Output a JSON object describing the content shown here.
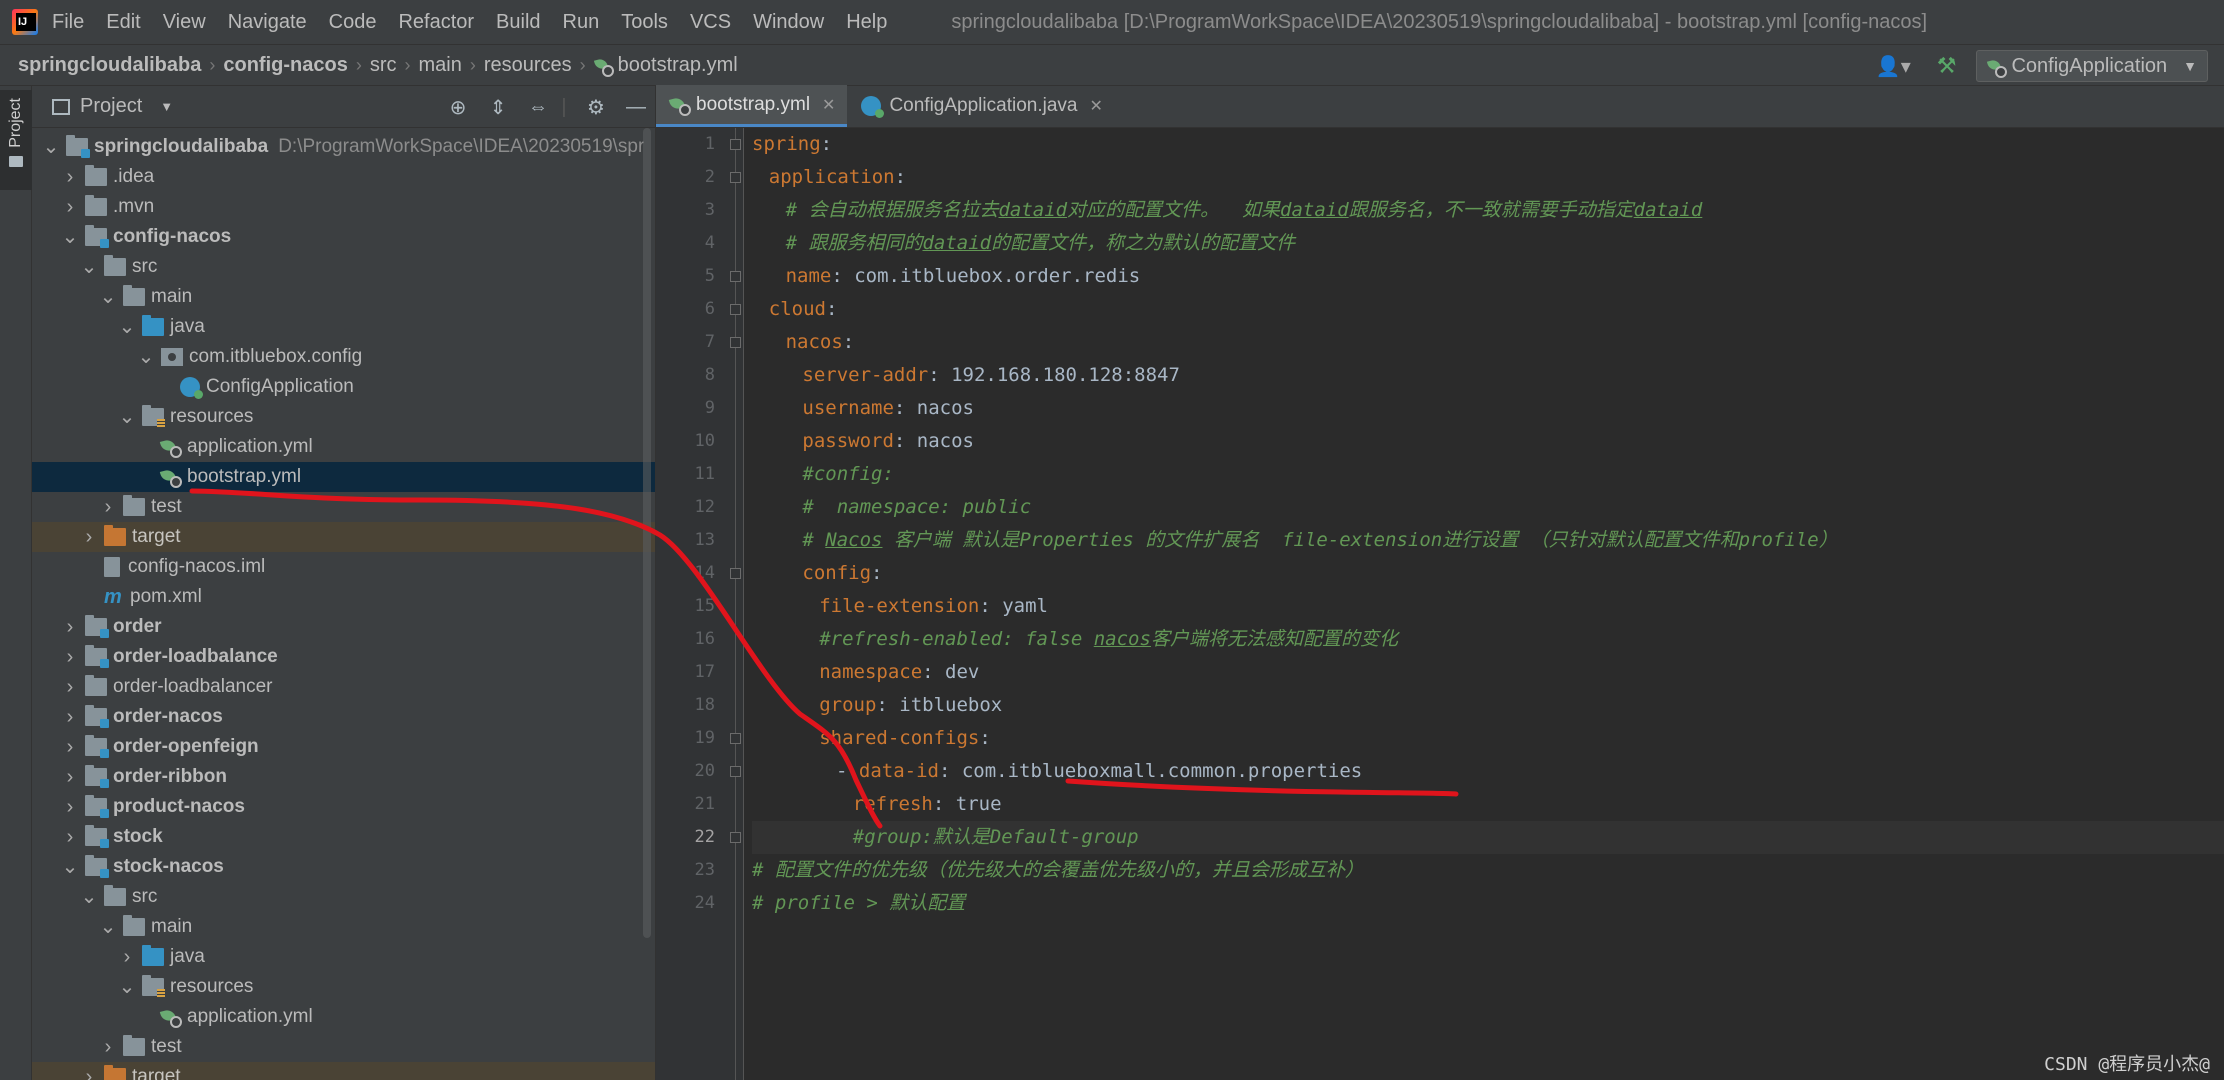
{
  "window": {
    "title": "springcloudalibaba [D:\\ProgramWorkSpace\\IDEA\\20230519\\springcloudalibaba] - bootstrap.yml [config-nacos]"
  },
  "menu": {
    "items": [
      "File",
      "Edit",
      "View",
      "Navigate",
      "Code",
      "Refactor",
      "Build",
      "Run",
      "Tools",
      "VCS",
      "Window",
      "Help"
    ]
  },
  "breadcrumb": {
    "items": [
      "springcloudalibaba",
      "config-nacos",
      "src",
      "main",
      "resources",
      "bootstrap.yml"
    ]
  },
  "toolbar": {
    "run_config": "ConfigApplication"
  },
  "side_strip": {
    "project_label": "Project"
  },
  "project_panel": {
    "title": "Project",
    "root_path": "D:\\ProgramWorkSpace\\IDEA\\20230519\\spr",
    "tree": [
      {
        "label": "springcloudalibaba",
        "indent": 0,
        "arrow": "down",
        "icon": "module",
        "bold": true
      },
      {
        "label": ".idea",
        "indent": 1,
        "arrow": "right",
        "icon": "folder"
      },
      {
        "label": ".mvn",
        "indent": 1,
        "arrow": "right",
        "icon": "folder"
      },
      {
        "label": "config-nacos",
        "indent": 1,
        "arrow": "down",
        "icon": "module",
        "bold": true
      },
      {
        "label": "src",
        "indent": 2,
        "arrow": "down",
        "icon": "folder"
      },
      {
        "label": "main",
        "indent": 3,
        "arrow": "down",
        "icon": "folder"
      },
      {
        "label": "java",
        "indent": 4,
        "arrow": "down",
        "icon": "src"
      },
      {
        "label": "com.itbluebox.config",
        "indent": 5,
        "arrow": "down",
        "icon": "package"
      },
      {
        "label": "ConfigApplication",
        "indent": 6,
        "arrow": "",
        "icon": "class"
      },
      {
        "label": "resources",
        "indent": 4,
        "arrow": "down",
        "icon": "resources"
      },
      {
        "label": "application.yml",
        "indent": 5,
        "arrow": "",
        "icon": "yml"
      },
      {
        "label": "bootstrap.yml",
        "indent": 5,
        "arrow": "",
        "icon": "yml",
        "selected": true
      },
      {
        "label": "test",
        "indent": 3,
        "arrow": "right",
        "icon": "folder"
      },
      {
        "label": "target",
        "indent": 2,
        "arrow": "right",
        "icon": "orange",
        "excluded": true
      },
      {
        "label": "config-nacos.iml",
        "indent": 2,
        "arrow": "",
        "icon": "iml"
      },
      {
        "label": "pom.xml",
        "indent": 2,
        "arrow": "",
        "icon": "maven"
      },
      {
        "label": "order",
        "indent": 1,
        "arrow": "right",
        "icon": "module",
        "bold": true
      },
      {
        "label": "order-loadbalance",
        "indent": 1,
        "arrow": "right",
        "icon": "module",
        "bold": true
      },
      {
        "label": "order-loadbalancer",
        "indent": 1,
        "arrow": "right",
        "icon": "folder"
      },
      {
        "label": "order-nacos",
        "indent": 1,
        "arrow": "right",
        "icon": "module",
        "bold": true
      },
      {
        "label": "order-openfeign",
        "indent": 1,
        "arrow": "right",
        "icon": "module",
        "bold": true
      },
      {
        "label": "order-ribbon",
        "indent": 1,
        "arrow": "right",
        "icon": "module",
        "bold": true
      },
      {
        "label": "product-nacos",
        "indent": 1,
        "arrow": "right",
        "icon": "module",
        "bold": true
      },
      {
        "label": "stock",
        "indent": 1,
        "arrow": "right",
        "icon": "module",
        "bold": true
      },
      {
        "label": "stock-nacos",
        "indent": 1,
        "arrow": "down",
        "icon": "module",
        "bold": true
      },
      {
        "label": "src",
        "indent": 2,
        "arrow": "down",
        "icon": "folder"
      },
      {
        "label": "main",
        "indent": 3,
        "arrow": "down",
        "icon": "folder"
      },
      {
        "label": "java",
        "indent": 4,
        "arrow": "right",
        "icon": "src"
      },
      {
        "label": "resources",
        "indent": 4,
        "arrow": "down",
        "icon": "resources"
      },
      {
        "label": "application.yml",
        "indent": 5,
        "arrow": "",
        "icon": "yml"
      },
      {
        "label": "test",
        "indent": 3,
        "arrow": "right",
        "icon": "folder"
      },
      {
        "label": "target",
        "indent": 2,
        "arrow": "right",
        "icon": "orange",
        "excluded": true
      }
    ]
  },
  "tabs": [
    {
      "label": "bootstrap.yml",
      "active": true,
      "icon": "yml"
    },
    {
      "label": "ConfigApplication.java",
      "active": false,
      "icon": "java"
    }
  ],
  "editor": {
    "current_line": 22,
    "lines": [
      {
        "n": 1,
        "indent": 0,
        "parts": [
          [
            "k",
            "spring"
          ],
          [
            "v",
            ":"
          ]
        ]
      },
      {
        "n": 2,
        "indent": 1,
        "parts": [
          [
            "k",
            "application"
          ],
          [
            "v",
            ":"
          ]
        ]
      },
      {
        "n": 3,
        "indent": 2,
        "parts": [
          [
            "c",
            "# 会自动根据服务名拉去"
          ],
          [
            "cu",
            "dataid"
          ],
          [
            "c",
            "对应的配置文件。  如果"
          ],
          [
            "cu",
            "dataid"
          ],
          [
            "c",
            "跟服务名，不一致就需要手动指定"
          ],
          [
            "cu",
            "dataid"
          ]
        ]
      },
      {
        "n": 4,
        "indent": 2,
        "parts": [
          [
            "c",
            "# 跟服务相同的"
          ],
          [
            "cu",
            "dataid"
          ],
          [
            "c",
            "的配置文件，称之为默认的配置文件"
          ]
        ]
      },
      {
        "n": 5,
        "indent": 2,
        "parts": [
          [
            "k",
            "name"
          ],
          [
            "v",
            ": com.itbluebox.order.redis"
          ]
        ]
      },
      {
        "n": 6,
        "indent": 1,
        "parts": [
          [
            "k",
            "cloud"
          ],
          [
            "v",
            ":"
          ]
        ]
      },
      {
        "n": 7,
        "indent": 2,
        "parts": [
          [
            "k",
            "nacos"
          ],
          [
            "v",
            ":"
          ]
        ]
      },
      {
        "n": 8,
        "indent": 3,
        "parts": [
          [
            "k",
            "server-addr"
          ],
          [
            "v",
            ": 192.168.180.128:8847"
          ]
        ]
      },
      {
        "n": 9,
        "indent": 3,
        "parts": [
          [
            "k",
            "username"
          ],
          [
            "v",
            ": nacos"
          ]
        ]
      },
      {
        "n": 10,
        "indent": 3,
        "parts": [
          [
            "k",
            "password"
          ],
          [
            "v",
            ": nacos"
          ]
        ]
      },
      {
        "n": 11,
        "indent": 3,
        "parts": [
          [
            "c",
            "#config:"
          ]
        ]
      },
      {
        "n": 12,
        "indent": 3,
        "parts": [
          [
            "c",
            "#  namespace: public"
          ]
        ]
      },
      {
        "n": 13,
        "indent": 3,
        "parts": [
          [
            "c",
            "# "
          ],
          [
            "cu",
            "Nacos"
          ],
          [
            "c",
            " 客户端 默认是Properties 的文件扩展名  file-extension进行设置 （只针对默认配置文件和profile）"
          ]
        ]
      },
      {
        "n": 14,
        "indent": 3,
        "parts": [
          [
            "k",
            "config"
          ],
          [
            "v",
            ":"
          ]
        ]
      },
      {
        "n": 15,
        "indent": 4,
        "parts": [
          [
            "k",
            "file-extension"
          ],
          [
            "v",
            ": yaml"
          ]
        ]
      },
      {
        "n": 16,
        "indent": 4,
        "parts": [
          [
            "c",
            "#refresh-enabled: false "
          ],
          [
            "cu",
            "nacos"
          ],
          [
            "c",
            "客户端将无法感知配置的变化"
          ]
        ]
      },
      {
        "n": 17,
        "indent": 4,
        "parts": [
          [
            "k",
            "namespace"
          ],
          [
            "v",
            ": dev"
          ]
        ]
      },
      {
        "n": 18,
        "indent": 4,
        "parts": [
          [
            "k",
            "group"
          ],
          [
            "v",
            ": itbluebox"
          ]
        ]
      },
      {
        "n": 19,
        "indent": 4,
        "parts": [
          [
            "k",
            "shared-configs"
          ],
          [
            "v",
            ":"
          ]
        ]
      },
      {
        "n": 20,
        "indent": 5,
        "parts": [
          [
            "v",
            "- "
          ],
          [
            "k",
            "data-id"
          ],
          [
            "v",
            ": com.itblueboxmall.common.properties"
          ]
        ]
      },
      {
        "n": 21,
        "indent": 6,
        "parts": [
          [
            "k",
            "refresh"
          ],
          [
            "v",
            ": true"
          ]
        ]
      },
      {
        "n": 22,
        "indent": 6,
        "parts": [
          [
            "c",
            "#group:默认是Default-group"
          ]
        ]
      },
      {
        "n": 23,
        "indent": 0,
        "parts": [
          [
            "c",
            "# 配置文件的优先级（优先级大的会覆盖优先级小的，并且会形成互补）"
          ]
        ]
      },
      {
        "n": 24,
        "indent": 0,
        "parts": [
          [
            "c",
            "# profile > 默认配置"
          ]
        ]
      }
    ],
    "fold_lines": [
      1,
      2,
      5,
      6,
      7,
      14,
      19,
      20,
      22
    ]
  },
  "watermark": "CSDN @程序员小杰@",
  "colors": {
    "keyword": "#cc7832",
    "comment": "#629755",
    "text": "#a9b7c6",
    "annotation": "#e8141b",
    "selection": "#0d293e"
  }
}
